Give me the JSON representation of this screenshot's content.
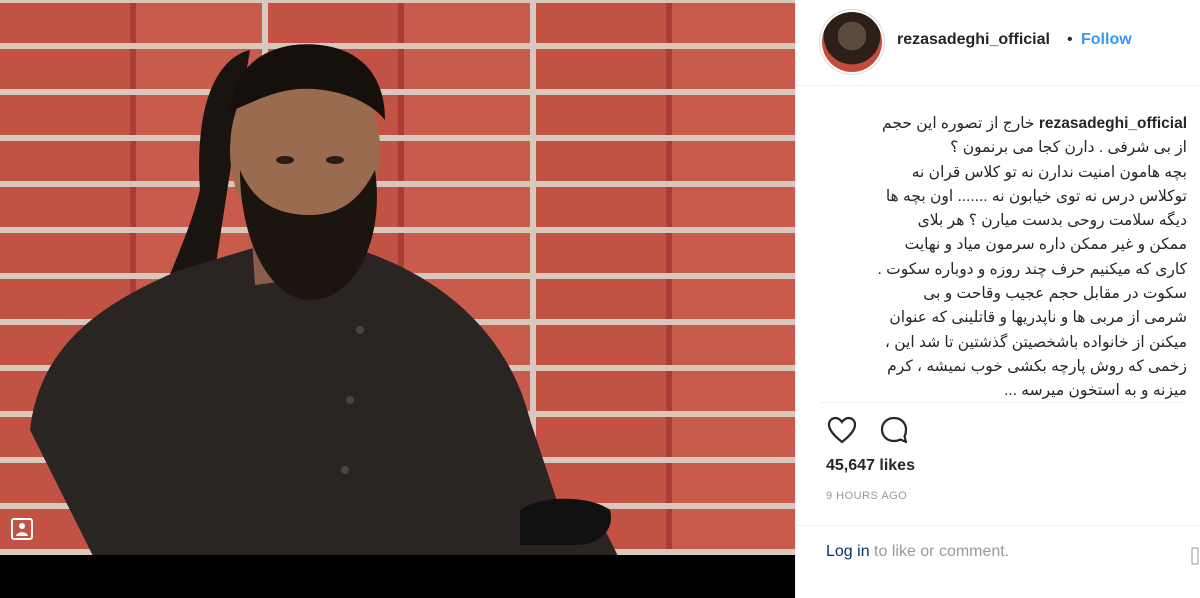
{
  "post": {
    "username": "rezasadeghi_official",
    "follow_label": "Follow",
    "caption_lines": [
      "خارج از تصوره این حجم",
      "از بی شرفی . دارن کجا می برنمون ؟",
      "بچه هامون امنیت ندارن نه تو کلاس قران نه",
      "توکلاس درس نه توی خیابون نه ....... اون بچه ها",
      "دیگه سلامت روحی بدست میارن ؟ هر بلای",
      "ممکن و غیر ممکن داره سرمون میاد و نهایت",
      "کاری که میکنیم حرف چند روزه و دوباره سکوت .",
      "سکوت در مقابل حجم عجیب وقاحت و بی",
      "شرمی از مربی ها و ناپدریها و قاتلینی که عنوان",
      "میکنن از خانواده باشخصیتن گذشتین تا شد این ،",
      "زخمی که روش پارچه بکشی خوب نمیشه ، کرم",
      "میزنه و به استخون میرسه ..."
    ],
    "likes": "45,647 likes",
    "time": "9 HOURS AGO",
    "login_link": "Log in",
    "login_rest": " to like or comment."
  },
  "icons": {
    "like": "heart-icon",
    "comment": "comment-icon",
    "save": "bookmark-square-icon"
  },
  "colors": {
    "follow": "#3897f0",
    "login_link": "#003569",
    "text": "#262626",
    "muted": "#999999"
  }
}
